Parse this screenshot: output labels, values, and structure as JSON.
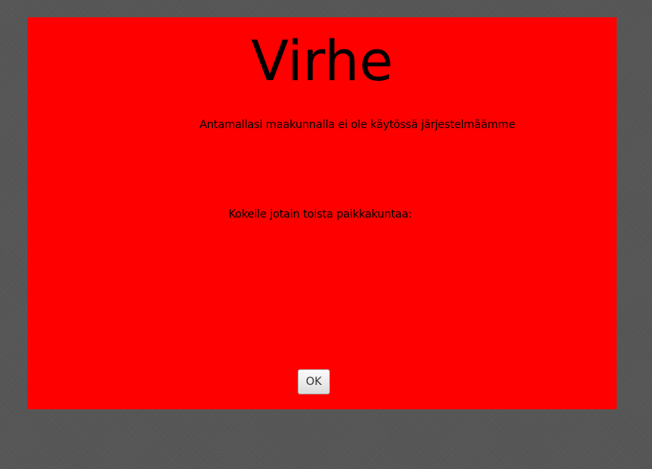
{
  "dialog": {
    "title": "Virhe",
    "message": "Antamallasi maakunnalla ei ole käytössä järjestelmäämme",
    "hint": "Kokeile jotain toista paikkakuntaa:",
    "ok_label": "OK",
    "background_color": "#ff0000"
  }
}
